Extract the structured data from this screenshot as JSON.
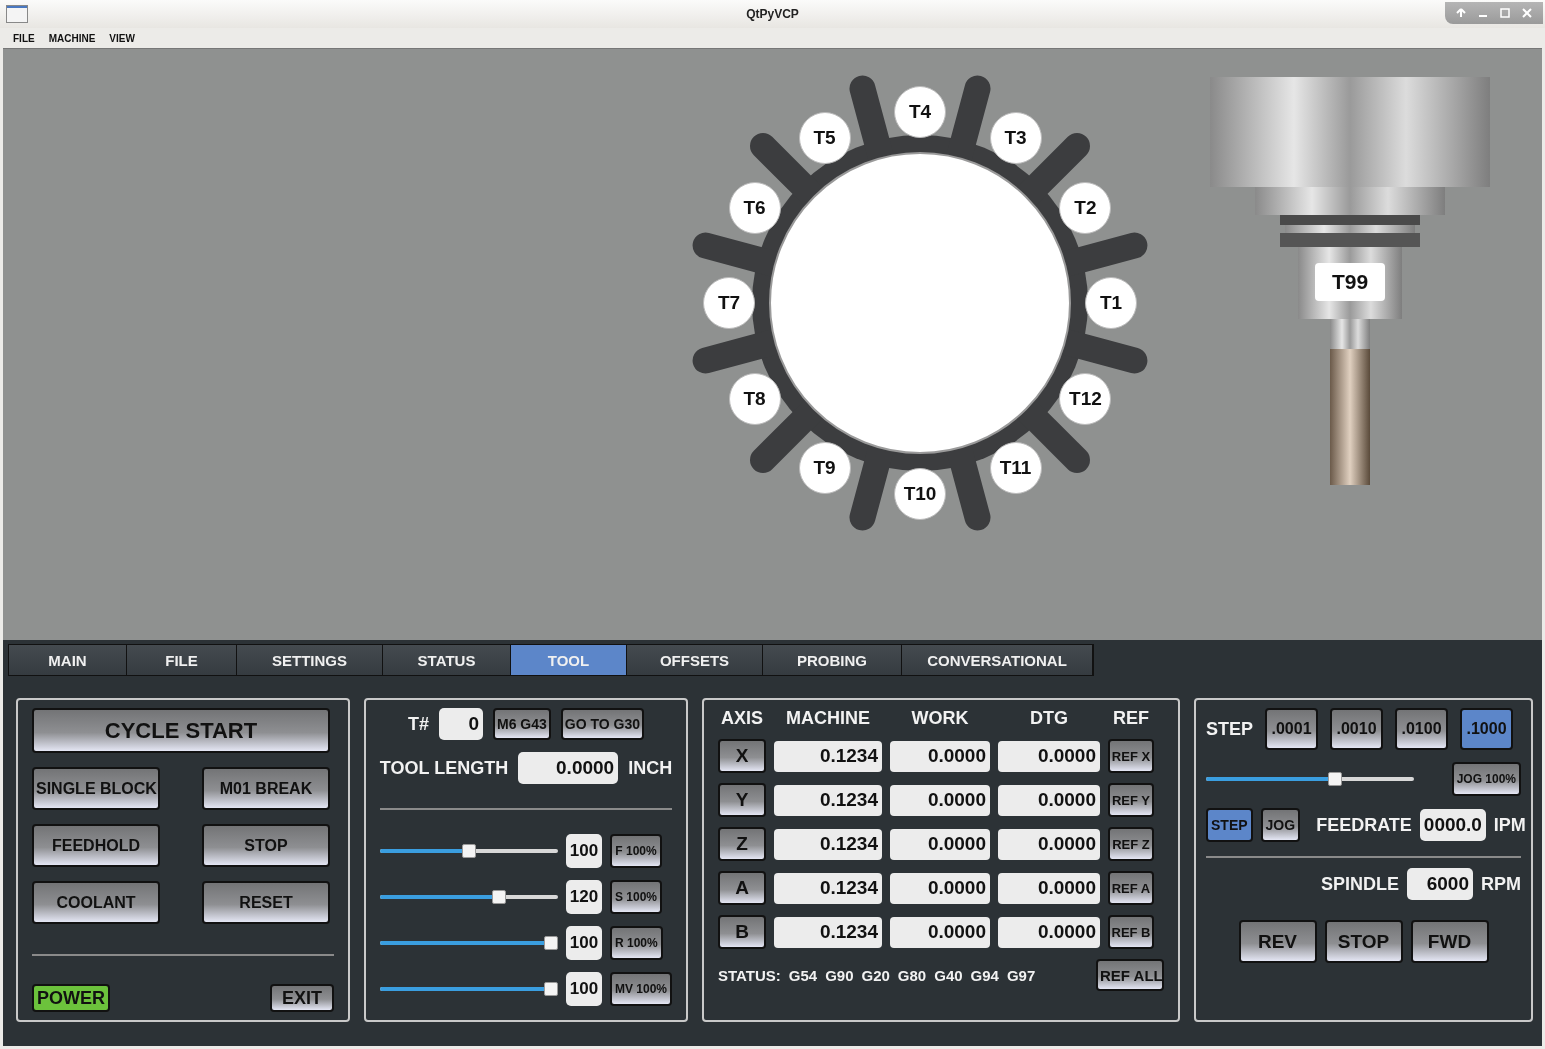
{
  "window": {
    "title": "QtPyVCP"
  },
  "menu": [
    "FILE",
    "MACHINE",
    "VIEW"
  ],
  "carousel": {
    "pockets": [
      "T1",
      "T2",
      "T3",
      "T4",
      "T5",
      "T6",
      "T7",
      "T8",
      "T9",
      "T10",
      "T11",
      "T12"
    ]
  },
  "spindle": {
    "tool": "T99"
  },
  "tabs": [
    {
      "label": "MAIN",
      "selected": false
    },
    {
      "label": "FILE",
      "selected": false
    },
    {
      "label": "SETTINGS",
      "selected": false
    },
    {
      "label": "STATUS",
      "selected": false
    },
    {
      "label": "TOOL",
      "selected": true
    },
    {
      "label": "OFFSETS",
      "selected": false
    },
    {
      "label": "PROBING",
      "selected": false
    },
    {
      "label": "CONVERSATIONAL",
      "selected": false
    }
  ],
  "controls": {
    "cycle_start": "CYCLE START",
    "buttons": [
      "SINGLE BLOCK",
      "M01 BREAK",
      "FEEDHOLD",
      "STOP",
      "COOLANT",
      "RESET"
    ],
    "power": {
      "label": "POWER",
      "on": true
    },
    "exit": "EXIT"
  },
  "tool": {
    "number_label": "T#",
    "number": "0",
    "buttons": [
      "M6 G43",
      "GO TO G30"
    ],
    "length_label": "TOOL LENGTH",
    "length": "0.0000",
    "length_unit": "INCH",
    "overrides": [
      {
        "level": 0.5,
        "value": "100",
        "button": "F 100%"
      },
      {
        "level": 0.68,
        "value": "120",
        "button": "S 100%"
      },
      {
        "level": 1,
        "value": "100",
        "button": "R 100%"
      },
      {
        "level": 1,
        "value": "100",
        "button": "MV 100%"
      }
    ]
  },
  "dro": {
    "columns": [
      "AXIS",
      "MACHINE",
      "WORK",
      "DTG",
      "REF"
    ],
    "rows": [
      {
        "axis": "X",
        "machine": "0.1234",
        "work": "0.0000",
        "dtg": "0.0000",
        "ref": "REF X"
      },
      {
        "axis": "Y",
        "machine": "0.1234",
        "work": "0.0000",
        "dtg": "0.0000",
        "ref": "REF Y"
      },
      {
        "axis": "Z",
        "machine": "0.1234",
        "work": "0.0000",
        "dtg": "0.0000",
        "ref": "REF Z"
      },
      {
        "axis": "A",
        "machine": "0.1234",
        "work": "0.0000",
        "dtg": "0.0000",
        "ref": "REF A"
      },
      {
        "axis": "B",
        "machine": "0.1234",
        "work": "0.0000",
        "dtg": "0.0000",
        "ref": "REF B"
      }
    ],
    "status_label": "STATUS:",
    "status_codes": [
      "G54",
      "G90",
      "G20",
      "G80",
      "G40",
      "G94",
      "G97"
    ],
    "ref_all": "REF ALL"
  },
  "jog": {
    "step_label": "STEP",
    "steps": [
      {
        "label": ".0001",
        "selected": false
      },
      {
        "label": ".0010",
        "selected": false
      },
      {
        "label": ".0100",
        "selected": false
      },
      {
        "label": ".1000",
        "selected": true
      }
    ],
    "slider": {
      "level": 0.63
    },
    "jog_button": "JOG 100%",
    "modes": [
      {
        "label": "STEP",
        "selected": true
      },
      {
        "label": "JOG",
        "selected": false
      }
    ],
    "feedrate_label": "FEEDRATE",
    "feedrate": "0000.0",
    "feedrate_unit": "IPM",
    "spindle_label": "SPINDLE",
    "spindle": "6000",
    "spindle_unit": "RPM",
    "spindle_buttons": [
      "REV",
      "STOP",
      "FWD"
    ]
  }
}
